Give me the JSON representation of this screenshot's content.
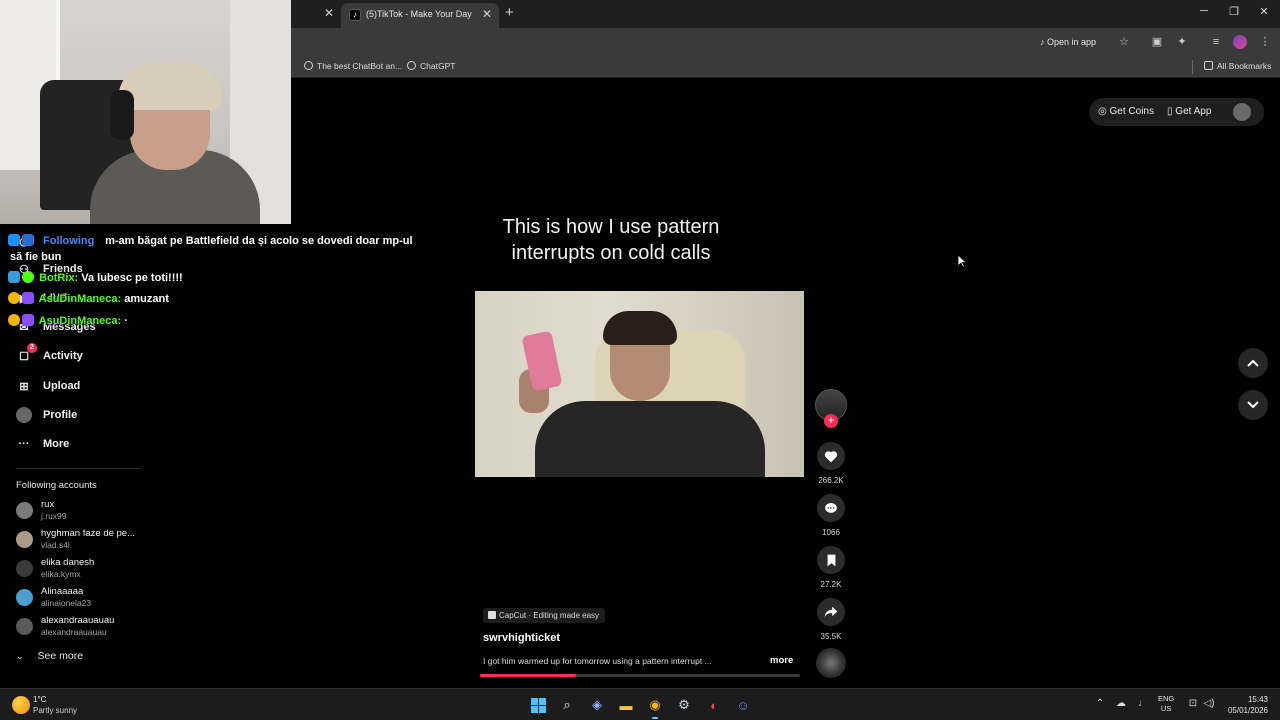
{
  "browser": {
    "active_tab_title": "(5)TikTok - Make Your Day",
    "open_in_app": "Open in app",
    "bookmarks": [
      "The best ChatBot an...",
      "ChatGPT"
    ],
    "all_bookmarks": "All Bookmarks"
  },
  "chat": {
    "messages": [
      {
        "user": "",
        "text": "m-am băgat pe Battlefield da și acolo se dovedi doar mp-ul"
      },
      {
        "user": "",
        "text": "să fie bun"
      },
      {
        "user": "BotRix:",
        "text": "Va lubesc pe toti!!!!"
      },
      {
        "user": "AsuDinManeca:",
        "text": "amuzant"
      },
      {
        "user": "AsuDinManeca:",
        "text": ""
      }
    ]
  },
  "sidebar": {
    "items": [
      {
        "label": "Following",
        "icon": "following-icon"
      },
      {
        "label": "Friends",
        "icon": "friends-icon"
      },
      {
        "label": "LIVE",
        "icon": "live-icon"
      },
      {
        "label": "Messages",
        "icon": "messages-icon"
      },
      {
        "label": "Activity",
        "icon": "activity-icon",
        "badge": "2"
      },
      {
        "label": "Upload",
        "icon": "upload-icon"
      },
      {
        "label": "Profile",
        "icon": "profile-icon"
      },
      {
        "label": "More",
        "icon": "more-icon"
      }
    ],
    "following_title": "Following accounts",
    "accounts": [
      {
        "name": "rux",
        "handle": "j.rux99"
      },
      {
        "name": "hyghman faze de pe...",
        "handle": "vlad.s4l"
      },
      {
        "name": "elika danesh",
        "handle": "elika.kymx"
      },
      {
        "name": "Alinaaaaa",
        "handle": "alinaionela23"
      },
      {
        "name": "alexandraauauau",
        "handle": "alexandraauauau"
      }
    ],
    "see_more": "See more"
  },
  "header": {
    "get_coins": "Get Coins",
    "get_app": "Get App"
  },
  "video": {
    "caption": "This is how I use pattern interrupts on cold calls",
    "capcut": "CapCut · Editing made easy",
    "author": "swrvhighticket",
    "description": "I got him warmed up for tomorrow using a pattern interrupt ...",
    "more": "more",
    "progress_fraction": 0.3
  },
  "actions": {
    "likes": "266.2K",
    "comments": "1066",
    "saves": "27.2K",
    "shares": "35.5K"
  },
  "taskbar": {
    "temp": "1°C",
    "weather": "Partly sunny",
    "lang1": "ENG",
    "lang2": "US",
    "time": "15:43",
    "date": "05/01/2026"
  },
  "colors": {
    "accent": "#fe2c55",
    "chat_user": "#53fc18"
  }
}
